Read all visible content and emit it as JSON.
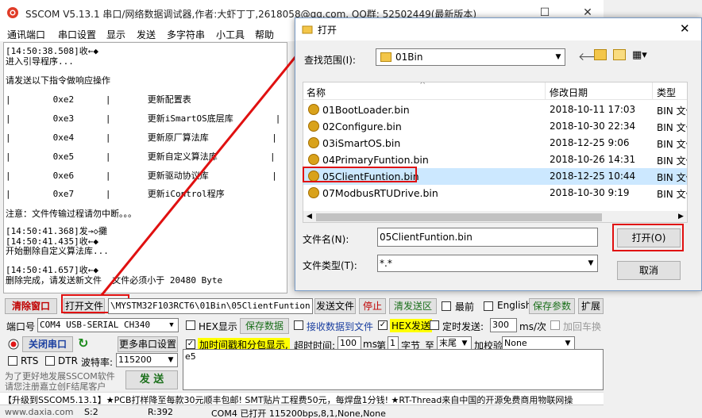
{
  "app": {
    "title": "SSCOM V5.13.1 串口/网络数据调试器,作者:大虾丁丁,2618058@qq.com. QQ群: 52502449(最新版本)"
  },
  "menu": [
    "通讯端口",
    "串口设置",
    "显示",
    "发送",
    "多字符串",
    "小工具",
    "帮助"
  ],
  "terminal": {
    "lines": [
      "[14:50:38.508]收←◆",
      "进入引导程序...",
      "",
      "请发送以下指令做响应操作",
      "|        0xe2      |       更新配置表",
      "|        0xe3      |       更新iSmartOS底层库        |",
      "|        0xe4      |       更新原厂算法库            |",
      "|        0xe5      |       更新自定义算法库          |",
      "|        0xe6      |       更新驱动协议库            |",
      "|        0xe7      |       更新iControl程序",
      "注意：文件传输过程请勿中断。。。",
      "",
      "[14:50:41.368]发→◇攤",
      "[14:50:41.435]收←◆",
      "开始删除自定义算法库...",
      "",
      "[14:50:41.657]收←◆",
      "删除完成，请发送新文件  文件必须小于 20480 Byte"
    ]
  },
  "toolbar1": {
    "clear": "清除窗口",
    "open_file": "打开文件",
    "file_path": "\\MYSTM32F103RCT6\\01Bin\\05ClientFuntion.bin",
    "send_file": "发送文件",
    "stop": "停止",
    "clear_send": "清发送区",
    "front": "最前",
    "english": "English",
    "save_params": "保存参数",
    "expand": "扩展"
  },
  "row2": {
    "port_label": "端口号",
    "port_value": "COM4 USB-SERIAL CH340",
    "hex_display": "HEX显示",
    "save_data": "保存数据",
    "recv_to_file": "接收数据到文件",
    "hex_send": "HEX发送",
    "timed_send": "定时发送:",
    "interval": "300",
    "interval_unit": "ms/次",
    "add_crlf": "加回车换"
  },
  "row3": {
    "close_port": "关闭串口",
    "more_settings": "更多串口设置",
    "timestamp": "加时间戳和分包显示,",
    "timeout_label": "超时时间:",
    "timeout": "100",
    "timeout_unit": "ms",
    "nth_label": "第",
    "nth": "1",
    "byte_label": "字节",
    "to_label": "至",
    "to_value": "末尾",
    "checksum_label": "加校验",
    "checksum_value": "None"
  },
  "row4": {
    "rts": "RTS",
    "dtr": "DTR",
    "baud_label": "波特率:",
    "baud": "115200",
    "send": "发 送",
    "send_text": "e5"
  },
  "promo": {
    "line1": "为了更好地发展SSCOM软件",
    "line2": "请您注册嘉立创F结尾客户"
  },
  "marquee": "【升级到SSCOM5.13.1】★PCB打样降至每款30元顺丰包邮! SMT贴片工程费50元，每焊盘1分钱! ★RT-Thread来自中国的开源免费商用物联网操",
  "status": {
    "site": "www.daxia.com",
    "s": "S:2",
    "r": "R:392",
    "port": "COM4 已打开  115200bps,8,1,None,None"
  },
  "dialog": {
    "title": "打开",
    "lookin_label": "查找范围(I):",
    "lookin_value": "01Bin",
    "col_name": "名称",
    "col_date": "修改日期",
    "col_type": "类型",
    "files": [
      {
        "name": "01BootLoader.bin",
        "date": "2018-10-11 17:03",
        "type": "BIN 文件"
      },
      {
        "name": "02Configure.bin",
        "date": "2018-10-30 22:34",
        "type": "BIN 文件"
      },
      {
        "name": "03iSmartOS.bin",
        "date": "2018-12-25 9:06",
        "type": "BIN 文件"
      },
      {
        "name": "04PrimaryFuntion.bin",
        "date": "2018-10-26 14:31",
        "type": "BIN 文件"
      },
      {
        "name": "05ClientFuntion.bin",
        "date": "2018-12-25 10:44",
        "type": "BIN 文件"
      },
      {
        "name": "07ModbusRTUDrive.bin",
        "date": "2018-10-30 9:19",
        "type": "BIN 文件"
      }
    ],
    "filename_label": "文件名(N):",
    "filename_value": "05ClientFuntion.bin",
    "filetype_label": "文件类型(T):",
    "filetype_value": "*.*",
    "open_btn": "打开(O)",
    "cancel_btn": "取消"
  }
}
